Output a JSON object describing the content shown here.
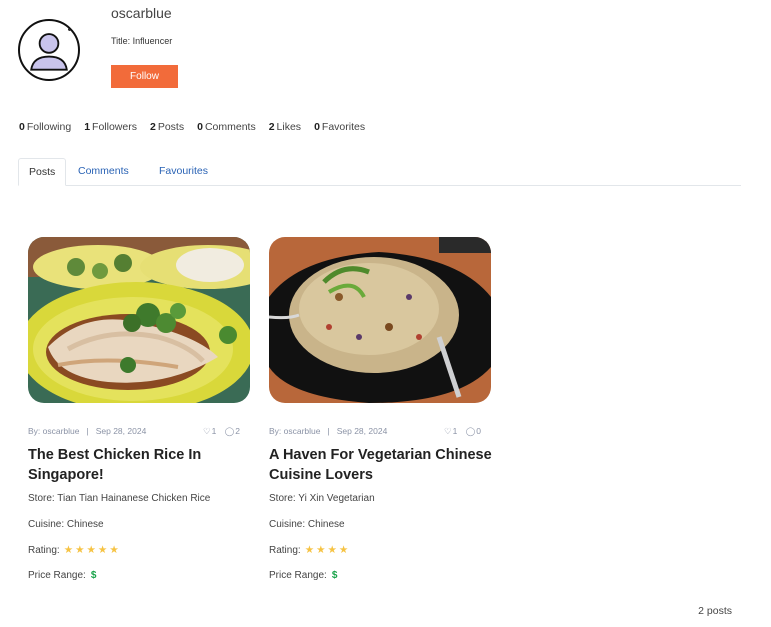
{
  "profile": {
    "username": "oscarblue",
    "title_line": "Title: Influencer",
    "follow_label": "Follow",
    "avatar_icon": "user-avatar-icon"
  },
  "stats": [
    {
      "count": "0",
      "label": "Following"
    },
    {
      "count": "1",
      "label": "Followers"
    },
    {
      "count": "2",
      "label": "Posts"
    },
    {
      "count": "0",
      "label": "Comments"
    },
    {
      "count": "2",
      "label": "Likes"
    },
    {
      "count": "0",
      "label": "Favorites"
    }
  ],
  "tabs": [
    {
      "label": "Posts",
      "active": true
    },
    {
      "label": "Comments",
      "active": false
    },
    {
      "label": "Favourites",
      "active": false
    }
  ],
  "posts": [
    {
      "author": "By: oscarblue",
      "date": "Sep 28, 2024",
      "likes": "1",
      "comments": "2",
      "title": "The Best Chicken Rice In Singapore!",
      "store": "Store: Tian Tian Hainanese Chicken Rice",
      "cuisine": "Cuisine: Chinese",
      "rating_label": "Rating:",
      "rating_stars": "★★★★★",
      "price_label": "Price Range:",
      "price": "$"
    },
    {
      "author": "By: oscarblue",
      "date": "Sep 28, 2024",
      "likes": "1",
      "comments": "0",
      "title": "A Haven For Vegetarian Chinese Cuisine Lovers",
      "store": "Store: Yi Xin Vegetarian",
      "cuisine": "Cuisine: Chinese",
      "rating_label": "Rating:",
      "rating_stars": "★★★★",
      "price_label": "Price Range:",
      "price": "$"
    }
  ],
  "footer": {
    "total": "2 posts"
  },
  "colors": {
    "accent": "#f26b3a",
    "link": "#2a63b5",
    "star": "#f6c343",
    "price": "#1aa34a"
  }
}
